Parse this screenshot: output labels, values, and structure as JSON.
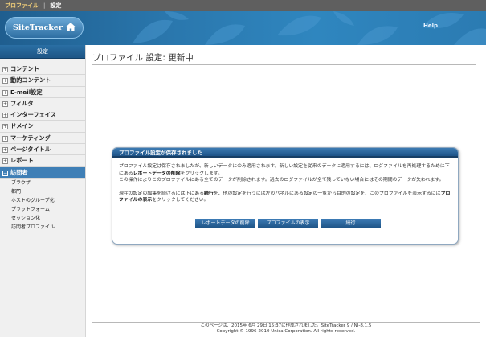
{
  "topnav": {
    "profile": "プロファイル",
    "separator": "|",
    "settings": "設定"
  },
  "banner": {
    "logo": "SiteTracker",
    "help": "Help"
  },
  "sidebar": {
    "title": "設定",
    "items": [
      {
        "label": "コンテント",
        "active": false
      },
      {
        "label": "動的コンテント",
        "active": false
      },
      {
        "label": "E-mail設定",
        "active": false
      },
      {
        "label": "フィルタ",
        "active": false
      },
      {
        "label": "インターフェイス",
        "active": false
      },
      {
        "label": "ドメイン",
        "active": false
      },
      {
        "label": "マーケティング",
        "active": false
      },
      {
        "label": "ページタイトル",
        "active": false
      },
      {
        "label": "レポート",
        "active": false
      },
      {
        "label": "訪問者",
        "active": true
      }
    ],
    "subitems": [
      "ブラウザ",
      "都門",
      "ホストのグループ化",
      "プラットフォーム",
      "セッション化",
      "訪問者プロファイル"
    ]
  },
  "main": {
    "title": "プロファイル 設定: 更新中",
    "dialog": {
      "title": "プロファイル設定が保存されました",
      "p1a": "プロファイル設定は保存されましたが、新しいデータにのみ適用されます。新しい設定を従来のデータに適用するには、ログファイルを再処理するために下にある",
      "p1b": "レポートデータの削除",
      "p1c": "をクリックします。",
      "p2": "この操作によりこのプロファイルにある全てのデータが削除されます。過去のログファイルが全て残っていない場合にはその期間のデータが失われます。",
      "p3a": "現在の設定の編集を続けるには下にある",
      "p3b": "続行",
      "p3c": "を、他の設定を行うには左のパネルにある設定の一覧から目的の設定を、このプロファイルを表示するには",
      "p3d": "プロファイルの表示",
      "p3e": "をクリックしてください。",
      "buttons": [
        "レポートデータの削除",
        "プロファイルの表示",
        "続行"
      ]
    }
  },
  "footer": {
    "line1": "このページは、2015年 6月 29日 15:37に作成されました。SiteTracker 9 / NI-8.1.5",
    "line2": "Copyright © 1996-2010 Unica Corporation. All rights reserved."
  }
}
